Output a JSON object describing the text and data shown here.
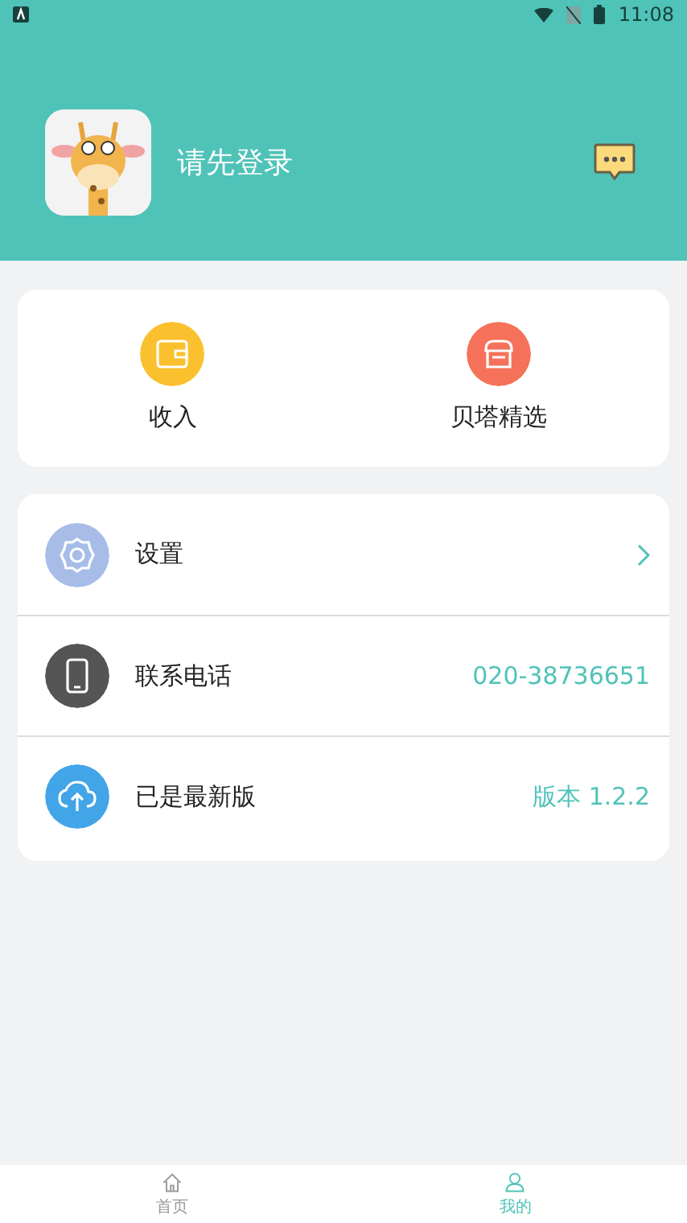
{
  "status_bar": {
    "time": "11:08"
  },
  "profile": {
    "name": "请先登录"
  },
  "shortcuts": [
    {
      "kind": "wallet",
      "label": "收入",
      "color": "#fbc02d"
    },
    {
      "kind": "store",
      "label": "贝塔精选",
      "color": "#f57159"
    }
  ],
  "menu": [
    {
      "kind": "settings",
      "label": "设置"
    },
    {
      "kind": "phone",
      "label": "联系电话",
      "value": "020-38736651"
    },
    {
      "kind": "update",
      "label": "已是最新版",
      "value": "版本 1.2.2"
    }
  ],
  "tabs": [
    {
      "kind": "home",
      "label": "首页",
      "selected": false
    },
    {
      "kind": "me",
      "label": "我的",
      "selected": true
    }
  ]
}
